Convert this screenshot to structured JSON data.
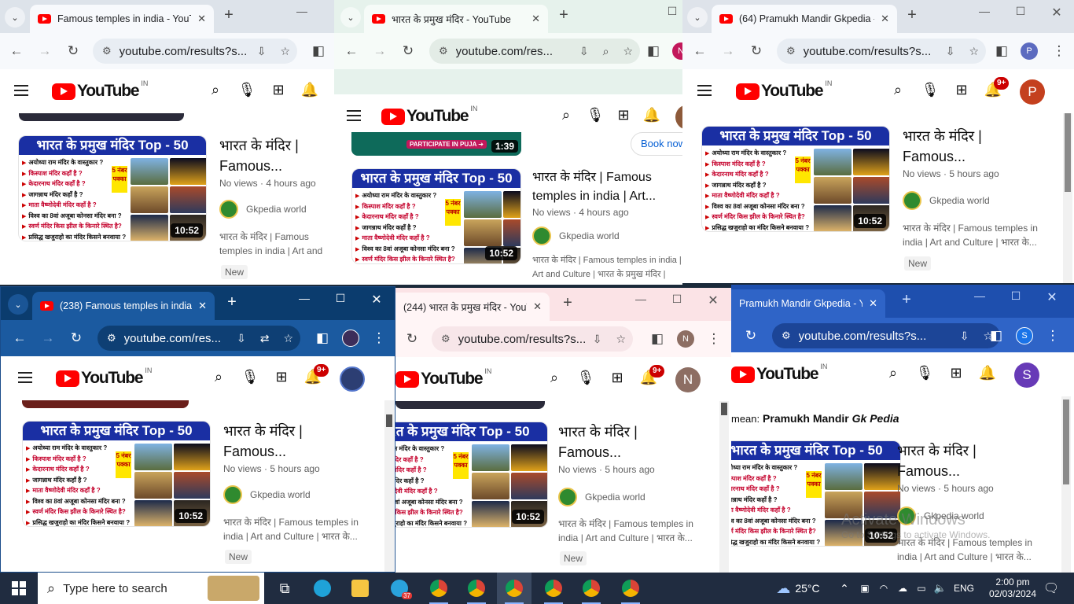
{
  "tabs": {
    "w1": "Famous temples in india - YouT",
    "w2": "भारत के प्रमुख मंदिर - YouTube",
    "w3": "(64) Pramukh Mandir Gkpedia -",
    "w4": "(238) Famous temples in india -",
    "w5": "(244) भारत के प्रमुख मंदिर - YouTu",
    "w6": "Pramukh Mandir Gkpedia - You"
  },
  "urls": {
    "w1": "youtube.com/results?s...",
    "w2": "youtube.com/res...",
    "w3": "youtube.com/results?s...",
    "w4": "youtube.com/res...",
    "w5": "youtube.com/results?s...",
    "w6": "youtube.com/results?s..."
  },
  "profiles": {
    "w2": "N",
    "w3": "P",
    "w5": "N",
    "w6": "S"
  },
  "yt": {
    "logo": "YouTube",
    "region": "IN",
    "badge": "9+",
    "avatars": {
      "w3": "P",
      "w5": "N",
      "w6": "S"
    },
    "book_now": "Book now",
    "participate": "PARTICIPATE IN PUJA ➔",
    "prev_duration": "1:39",
    "did_you_mean_prefix": "mean:",
    "did_you_mean_a": "Pramukh Mandir",
    "did_you_mean_b": "Gk Pedia"
  },
  "video": {
    "thumb_title": "भारत के प्रमुख मंदिर Top - 50",
    "thumb_title_cut": "के प्रमुख मंदिर Top - 50",
    "thumb_lines": [
      "अयोध्या राम मंदिर के वास्तुकार ?",
      "किस्पाश मंदिर कहाँ है ?",
      "केदारनाथ मंदिर कहाँ है ?",
      "जागन्नाथ मंदिर कहाँ है ?",
      "माता वैष्णोदेवी मंदिर कहाँ है ?",
      "विश्व का 8वां अजूबा कोनसा मंदिर बना ?",
      "स्वर्ण मंदिर किस झील के किनारे स्थित है?",
      "प्रसिद्ध खजुराहो का मंदिर किसने बनवाया ?"
    ],
    "sticker": "5 नंबर पक्का",
    "duration": "10:52",
    "title_short": "भारत के मंदिर | Famous...",
    "title_long": "भारत के मंदिर | Famous temples in india | Art...",
    "views_4h": "No views · 4 hours ago",
    "views_5h": "No views · 5 hours ago",
    "channel": "Gkpedia world",
    "desc_a": "भारत के मंदिर | Famous temples in india | Art and Culture | भारत के...",
    "desc_b": "भारत के मंदिर | Famous temples in india | Art and Culture | भारत के प्रमुख मंदिर | Pramukh",
    "new_badge": "New"
  },
  "watermark": {
    "line1": "Activate Windows",
    "line2": "Go to Settings to activate Windows."
  },
  "taskbar": {
    "search_placeholder": "Type here to search",
    "weather": "25°C",
    "lang": "ENG",
    "time": "2:00 pm",
    "date": "02/03/2024",
    "telegram_badge": "37"
  }
}
